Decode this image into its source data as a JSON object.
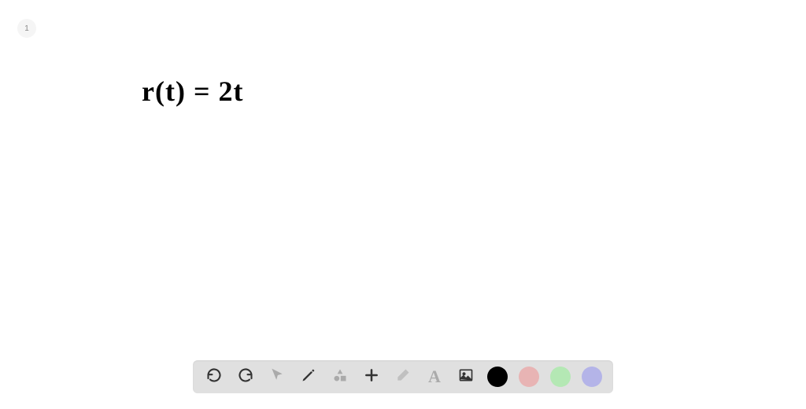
{
  "page": {
    "number": "1"
  },
  "canvas": {
    "content": "r(t) = 2t"
  },
  "toolbar": {
    "tools": {
      "undo": "undo",
      "redo": "redo",
      "pointer": "pointer",
      "pen": "pen",
      "shapes": "shapes",
      "add": "add",
      "eraser": "eraser",
      "text": "A",
      "image": "image"
    },
    "colors": {
      "black": "#000000",
      "red": "#e8b4b4",
      "green": "#b4e8b4",
      "purple": "#b4b4e8"
    }
  }
}
